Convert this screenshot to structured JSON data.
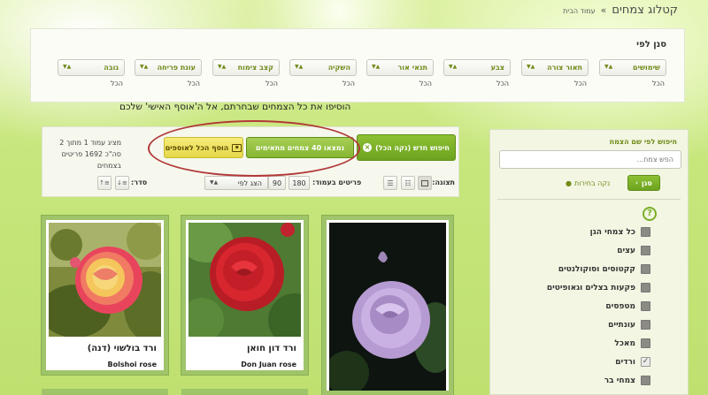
{
  "breadcrumb": {
    "home": "עמוד הבית",
    "separator": "»",
    "title": "קטלוג צמחים"
  },
  "filters": {
    "title": "סנן לפי",
    "dropdowns": [
      {
        "label": "שימושים",
        "value": "הכל"
      },
      {
        "label": "תאור צורה",
        "value": "הכל"
      },
      {
        "label": "צבע",
        "value": "הכל"
      },
      {
        "label": "תנאי אור",
        "value": "הכל"
      },
      {
        "label": "השקיה",
        "value": "הכל"
      },
      {
        "label": "קצב צימוח",
        "value": "הכל"
      },
      {
        "label": "עונת פריחה",
        "value": "הכל"
      },
      {
        "label": "גובה",
        "value": "הכל"
      }
    ]
  },
  "annotation": "הוסיפו את  כל הצמחים שבחרתם, אל ה'אוסף האישי' שלכם",
  "toolbar": {
    "new_search": "חיפוש חדש (נקה הכל)",
    "found": "נמצאו 40 צמחים מתאימים",
    "add_all": "הוסף הכל לאוספים",
    "info_line1": "מציג עמוד 1 מתוך 2",
    "info_line2": "סה\"כ 1692 פריטים בצמחים",
    "view_label": "תצוגה:",
    "per_page_label": "פריטים בעמוד:",
    "per_page_options": [
      "180",
      "90",
      "30"
    ],
    "per_page_selected": "30",
    "sort_label": "סדר:",
    "sort_value": "הצג לפי"
  },
  "sidebar": {
    "search_title": "חיפוש לפי שם הצמח",
    "search_placeholder": "הפש צמח...",
    "filter_button": "סנן",
    "clear_label": "נקה בחירות",
    "categories": [
      {
        "label": "כל צמחי הגן",
        "checked": false
      },
      {
        "label": "עצים",
        "checked": false
      },
      {
        "label": "קקטוסים וסוקולנטים",
        "checked": false
      },
      {
        "label": "פקעות בצלים וגאופיטים",
        "checked": false
      },
      {
        "label": "מטפסים",
        "checked": false
      },
      {
        "label": "עונתיים",
        "checked": false
      },
      {
        "label": "מאכל",
        "checked": false
      },
      {
        "label": "ורדים",
        "checked": true
      },
      {
        "label": "צמחי בר",
        "checked": false
      }
    ]
  },
  "products": [
    {
      "name_he": "ורד בולשוי (דנה)",
      "name_en": "Bolshoi rose"
    },
    {
      "name_he": "ורד דון חואן",
      "name_en": "Don Juan rose"
    },
    {
      "name_he": "",
      "name_en": ""
    }
  ],
  "colors": {
    "accent_green": "#7aae25",
    "brand_green_text": "#6f8a17",
    "highlight_circle": "#b23a3a",
    "card_border": "#9fc46a"
  }
}
